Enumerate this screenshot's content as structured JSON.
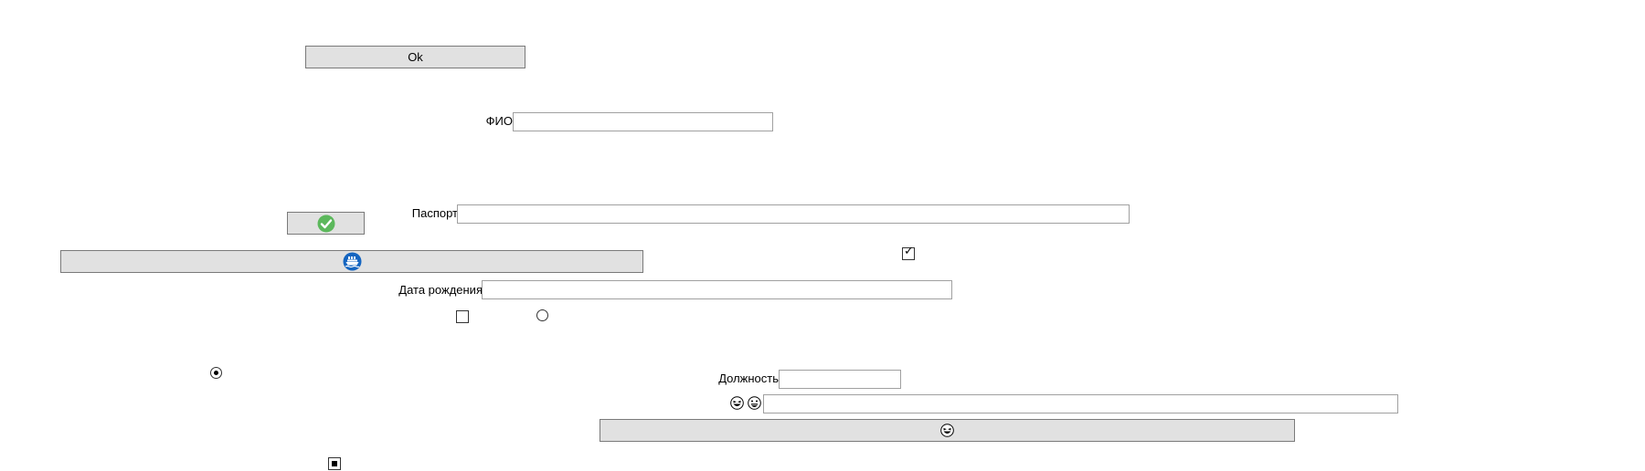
{
  "buttons": {
    "ok_label": "Ok",
    "check_icon": "green-check-circle-icon",
    "ship_icon": "blue-ship-circle-icon",
    "emoji_icon": "grinning-face-icon"
  },
  "fields": {
    "fio_label": "ФИО",
    "fio_value": "",
    "passport_label": "Паспорт",
    "passport_value": "",
    "birthdate_label": "Дата рождения",
    "birthdate_value": "",
    "position_label": "Должность",
    "position_value": "",
    "emoji_field_value": ""
  },
  "emoji_labels": {
    "first_icon": "laughing-face-icon",
    "second_icon": "grinning-face-icon"
  },
  "controls": {
    "checkbox_top_checked": true,
    "checkbox_mid_checked": false,
    "radio_mid_selected": false,
    "radio_left_selected": true,
    "checkbox_bottom_state": "indeterminate"
  },
  "colors": {
    "button_bg": "#e1e1e1",
    "button_border": "#7a7a7a",
    "field_border": "#a0a0a0",
    "check_green": "#5cb85c",
    "ship_blue": "#1565c0"
  }
}
